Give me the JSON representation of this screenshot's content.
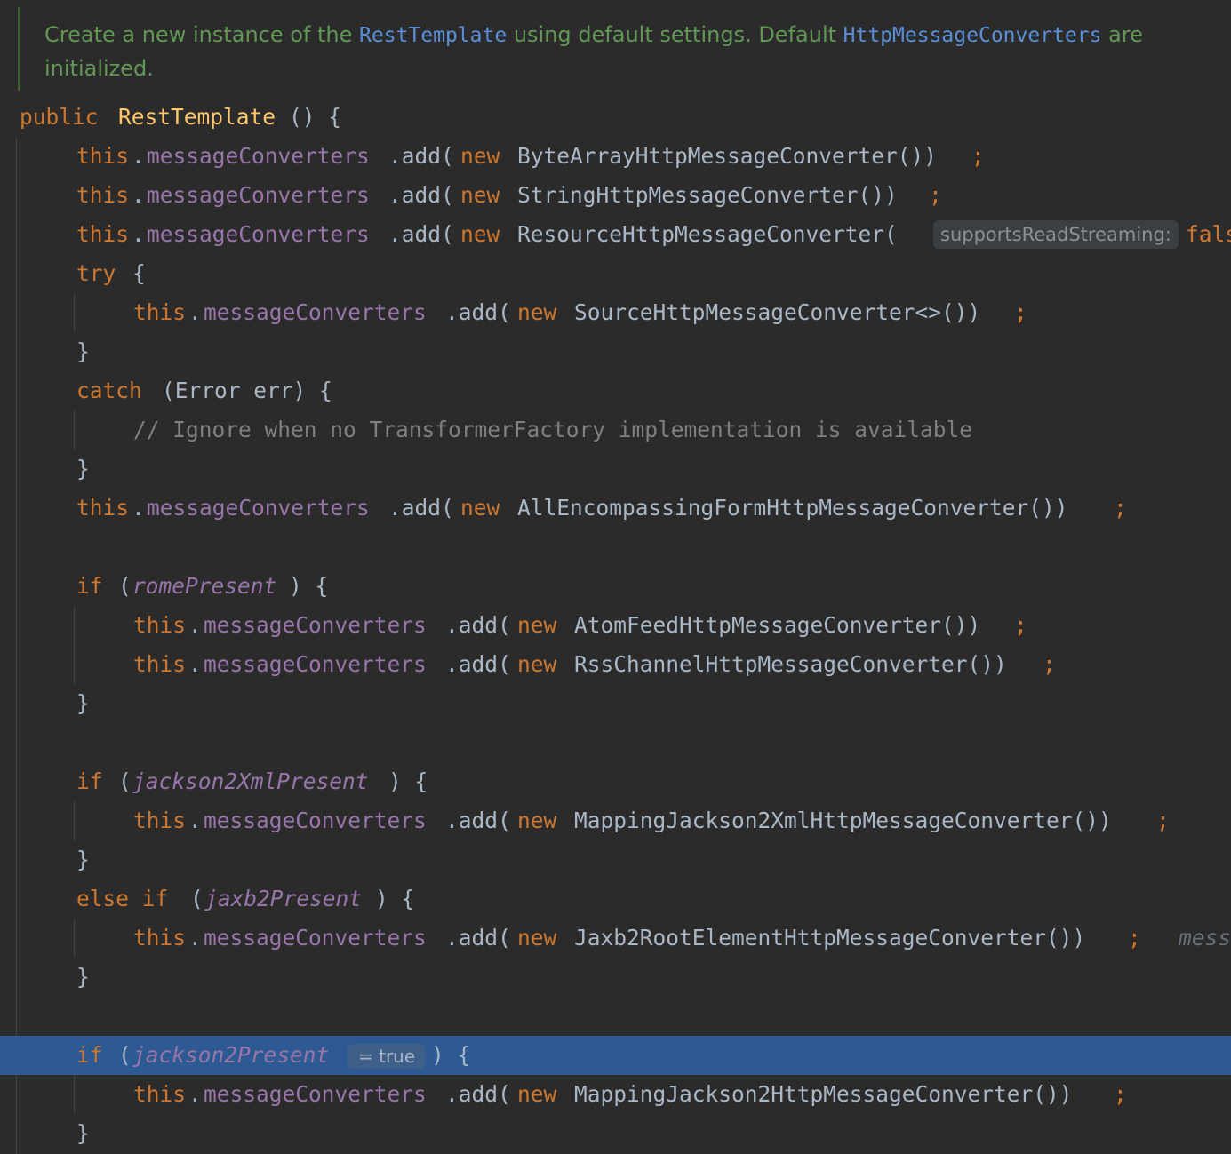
{
  "javadoc": {
    "line1": {
      "text_a": "Create a new instance of the ",
      "code_a": "RestTemplate",
      "text_b": " using default settings. Default ",
      "code_b": "HttpMessageConverters",
      "text_c": " are"
    },
    "line2": "initialized."
  },
  "code": {
    "l1": {
      "kw": "public",
      "name": "RestTemplate",
      "rest": "() {"
    },
    "l2": {
      "this": "this",
      "field": "messageConverters",
      "call": ".add(",
      "new": "new",
      "ctor": "ByteArrayHttpMessageConverter())",
      "semi": ";"
    },
    "l3": {
      "this": "this",
      "field": "messageConverters",
      "call": ".add(",
      "new": "new",
      "ctor": "StringHttpMessageConverter())",
      "semi": ";"
    },
    "l4": {
      "this": "this",
      "field": "messageConverters",
      "call": ".add(",
      "new": "new",
      "ctor": "ResourceHttpMessageConverter(",
      "hint": "supportsReadStreaming:",
      "arg": "fals"
    },
    "l5": {
      "kw": "try",
      "rest": "{"
    },
    "l6": {
      "this": "this",
      "field": "messageConverters",
      "call": ".add(",
      "new": "new",
      "ctor": "SourceHttpMessageConverter<>())",
      "semi": ";"
    },
    "l7": {
      "rest": "}"
    },
    "l8": {
      "kw": "catch",
      "rest": "(Error err) {"
    },
    "l9": {
      "comment": "// Ignore when no TransformerFactory implementation is available"
    },
    "l10": {
      "rest": "}"
    },
    "l11": {
      "this": "this",
      "field": "messageConverters",
      "call": ".add(",
      "new": "new",
      "ctor": "AllEncompassingFormHttpMessageConverter())",
      "semi": ";"
    },
    "l13": {
      "kw": "if",
      "open": "(",
      "cond": "romePresent",
      "close": ") {"
    },
    "l14": {
      "this": "this",
      "field": "messageConverters",
      "call": ".add(",
      "new": "new",
      "ctor": "AtomFeedHttpMessageConverter())",
      "semi": ";"
    },
    "l15": {
      "this": "this",
      "field": "messageConverters",
      "call": ".add(",
      "new": "new",
      "ctor": "RssChannelHttpMessageConverter())",
      "semi": ";"
    },
    "l16": {
      "rest": "}"
    },
    "l18": {
      "kw": "if",
      "open": "(",
      "cond": "jackson2XmlPresent",
      "close": ") {"
    },
    "l19": {
      "this": "this",
      "field": "messageConverters",
      "call": ".add(",
      "new": "new",
      "ctor": "MappingJackson2XmlHttpMessageConverter())",
      "semi": ";"
    },
    "l20": {
      "rest": "}"
    },
    "l21": {
      "kw": "else if",
      "open": "(",
      "cond": "jaxb2Present",
      "close": ") {"
    },
    "l22": {
      "this": "this",
      "field": "messageConverters",
      "call": ".add(",
      "new": "new",
      "ctor": "Jaxb2RootElementHttpMessageConverter())",
      "semi": ";",
      "trail": "mess"
    },
    "l23": {
      "rest": "}"
    },
    "l25": {
      "kw": "if",
      "open": "(",
      "cond": "jackson2Present",
      "eval": "= true",
      "close": ") {"
    },
    "l26": {
      "this": "this",
      "field": "messageConverters",
      "call": ".add(",
      "new": "new",
      "ctor": "MappingJackson2HttpMessageConverter())",
      "semi": ";"
    },
    "l27": {
      "rest": "}"
    }
  },
  "colors": {
    "background": "#2b2b2b",
    "keyword": "#cc7832",
    "method_decl": "#ffc66d",
    "field": "#9876aa",
    "comment": "#808080",
    "javadoc": "#629755",
    "execution_line": "#2d5a93"
  }
}
